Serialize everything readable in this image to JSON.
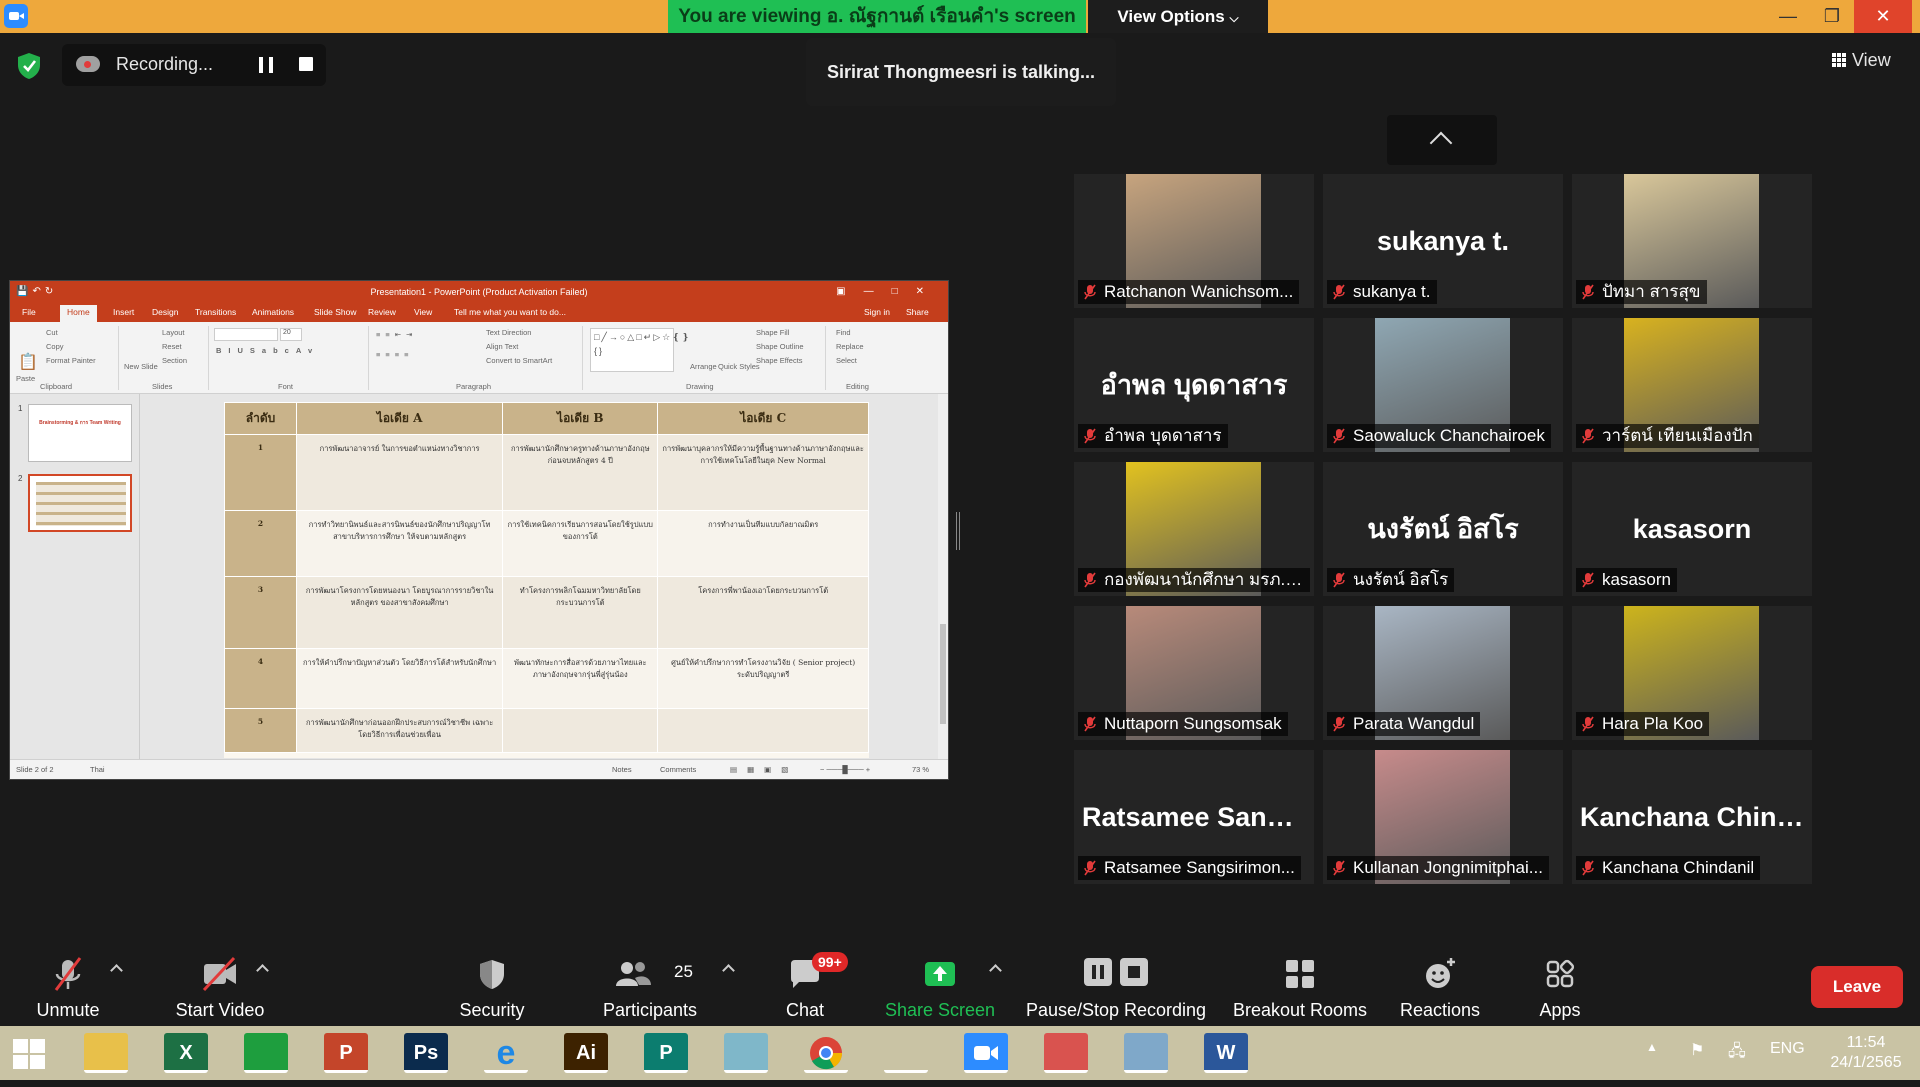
{
  "window": {
    "viewing_banner": "You are viewing อ. ณัฐกานต์  เรือนคำ's screen",
    "view_options_label": "View Options",
    "minimize": "—",
    "restore": "❐",
    "close": "✕"
  },
  "recording": {
    "label": "Recording..."
  },
  "talking_notice": "Sirirat Thongmeesri is talking...",
  "view_button_label": "View",
  "shared_screen": {
    "title": "Presentation1 - PowerPoint (Product Activation Failed)",
    "tabs": [
      "File",
      "Home",
      "Insert",
      "Design",
      "Transitions",
      "Animations",
      "Slide Show",
      "Review",
      "View"
    ],
    "tell_me": "Tell me what you want to do...",
    "sign_in": "Sign in",
    "share": "Share",
    "ribbon": {
      "paste": "Paste",
      "cut": "Cut",
      "copy": "Copy",
      "format_painter": "Format Painter",
      "clipboard": "Clipboard",
      "new_slide": "New Slide",
      "layout": "Layout",
      "reset": "Reset",
      "section": "Section",
      "slides": "Slides",
      "font": "Font",
      "paragraph": "Paragraph",
      "text_direction": "Text Direction",
      "align_text": "Align Text",
      "convert_smartart": "Convert to SmartArt",
      "drawing": "Drawing",
      "arrange": "Arrange",
      "quick_styles": "Quick Styles",
      "shape_fill": "Shape Fill",
      "shape_outline": "Shape Outline",
      "shape_effects": "Shape Effects",
      "find": "Find",
      "replace": "Replace",
      "select": "Select",
      "editing": "Editing",
      "font_size": "20"
    },
    "thumbnails": [
      {
        "num": "1",
        "title": "Brainstorming & การ Team Writing"
      },
      {
        "num": "2",
        "title": ""
      }
    ],
    "slide_table": {
      "headers": [
        "ลำดับ",
        "ไอเดีย A",
        "ไอเดีย B",
        "ไอเดีย C"
      ],
      "rows": [
        [
          "1",
          "การพัฒนาอาจารย์ ในการขอตำแหน่งทางวิชาการ",
          "การพัฒนานักศึกษาครูทางด้านภาษาอังกฤษก่อนจบหลักสูตร 4 ปี",
          "การพัฒนาบุคลากรให้มีความรู้พื้นฐานทางด้านภาษาอังกฤษและการใช้เทคโนโลยีในยุค New Normal"
        ],
        [
          "2",
          "การทำวิทยานิพนธ์และสารนิพนธ์ของนักศึกษาปริญญาโท สาขาบริหารการศึกษา ให้จบตามหลักสูตร",
          "การใช้เทคนิคการเรียนการสอนโดยใช้รูปแบบของการโต้",
          "การทำงานเป็นทีมแบบกัลยาณมิตร"
        ],
        [
          "3",
          "การพัฒนาโครงการโดยหนองนา โดยบูรณาการรายวิชาในหลักสูตร ของสาขาสังคมศึกษา",
          "ทำโครงการพลิกโฉมมหาวิทยาลัยโดยกระบวนการโต้",
          "โครงการพี่พาน้องเอาโดยกระบวนการโต้"
        ],
        [
          "4",
          "การให้คำปรึกษาปัญหาส่วนตัว โดยวิธีการโต้สำหรับนักศึกษา",
          "พัฒนาทักษะการสื่อสารด้วยภาษาไทยและภาษาอังกฤษจากรุ่นพี่สู่รุ่นน้อง",
          "ศูนย์ให้คำปรึกษาการทำโครงงานวิจัย ( Senior project) ระดับปริญญาตรี"
        ],
        [
          "5",
          "การพัฒนานักศึกษาก่อนออกฝึกประสบการณ์วิชาชีพ เฉพาะโดยวิธีการเพื่อนช่วยเพื่อน",
          "",
          ""
        ]
      ]
    },
    "status": {
      "slide": "Slide 2 of 2",
      "language": "Thai",
      "notes": "Notes",
      "comments": "Comments",
      "zoom": "73 %"
    }
  },
  "participants_tiles": [
    {
      "name": "Ratchanon Wanichsom...",
      "display": "",
      "photo": "#c7a47e"
    },
    {
      "name": "sukanya t.",
      "display": "sukanya t.",
      "photo": ""
    },
    {
      "name": "ปัทมา สารสุข",
      "display": "",
      "photo": "#d9c79a"
    },
    {
      "name": "อำพล บุดดาสาร",
      "display": "อำพล บุดดาสาร",
      "photo": ""
    },
    {
      "name": "Saowaluck Chanchairoek",
      "display": "",
      "photo": "#8fa7b3"
    },
    {
      "name": "วาร์ตน์ เทียนเมืองปัก",
      "display": "",
      "photo": "#d8b21f"
    },
    {
      "name": "กองพัฒนานักศึกษา มรภ.พร...",
      "display": "",
      "photo": "#e2c21f"
    },
    {
      "name": "นงรัตน์ อิสโร",
      "display": "นงรัตน์ อิสโร",
      "photo": ""
    },
    {
      "name": "kasasorn",
      "display": "kasasorn",
      "photo": ""
    },
    {
      "name": "Nuttaporn Sungsomsak",
      "display": "",
      "photo": "#b88a7a"
    },
    {
      "name": "Parata Wangdul",
      "display": "",
      "photo": "#a9b6c4"
    },
    {
      "name": "Hara Pla Koo",
      "display": "",
      "photo": "#cdb41c"
    },
    {
      "name": "Ratsamee Sangsirimon...",
      "display": "Ratsamee  Sangs...",
      "photo": ""
    },
    {
      "name": "Kullanan Jongnimitphai...",
      "display": "",
      "photo": "#c78b8b"
    },
    {
      "name": "Kanchana Chindanil",
      "display": "Kanchana  Chind...",
      "photo": ""
    }
  ],
  "toolbar": {
    "unmute": "Unmute",
    "start_video": "Start Video",
    "security": "Security",
    "participants": "Participants",
    "participants_count": "25",
    "chat": "Chat",
    "chat_badge": "99+",
    "share_screen": "Share Screen",
    "pause_stop_recording": "Pause/Stop Recording",
    "breakout_rooms": "Breakout Rooms",
    "reactions": "Reactions",
    "apps": "Apps",
    "leave": "Leave"
  },
  "taskbar": {
    "apps": [
      {
        "name": "file-explorer",
        "glyph": "",
        "color": "#e8c04a"
      },
      {
        "name": "excel",
        "glyph": "X",
        "color": "#1d7044"
      },
      {
        "name": "store",
        "glyph": "",
        "color": "#1e9e3e"
      },
      {
        "name": "powerpoint",
        "glyph": "P",
        "color": "#c4452a"
      },
      {
        "name": "photoshop",
        "glyph": "Ps",
        "color": "#0b2b4d"
      },
      {
        "name": "internet-explorer",
        "glyph": "e",
        "color": "#c9c3a4"
      },
      {
        "name": "illustrator",
        "glyph": "Ai",
        "color": "#3d2200"
      },
      {
        "name": "publisher",
        "glyph": "P",
        "color": "#0c7d6f"
      },
      {
        "name": "notebook",
        "glyph": "",
        "color": "#7fb7c9"
      },
      {
        "name": "chrome",
        "glyph": "",
        "color": "#c9c3a4"
      },
      {
        "name": "paint",
        "glyph": "",
        "color": "#c9c3a4"
      },
      {
        "name": "zoom",
        "glyph": "",
        "color": "#2d8cff"
      },
      {
        "name": "photos",
        "glyph": "",
        "color": "#d9534f"
      },
      {
        "name": "control-panel",
        "glyph": "",
        "color": "#7fa8c9"
      },
      {
        "name": "word",
        "glyph": "W",
        "color": "#2b579a"
      }
    ],
    "language": "ENG",
    "time": "11:54",
    "date": "24/1/2565"
  },
  "colors": {
    "banner_green": "#1fbf54",
    "titlebar_orange": "#eea83c",
    "leave_red": "#d92d2a",
    "share_green": "#1fbf54",
    "muted_red": "#e23b3b",
    "ppt_orange": "#c43e1c"
  }
}
